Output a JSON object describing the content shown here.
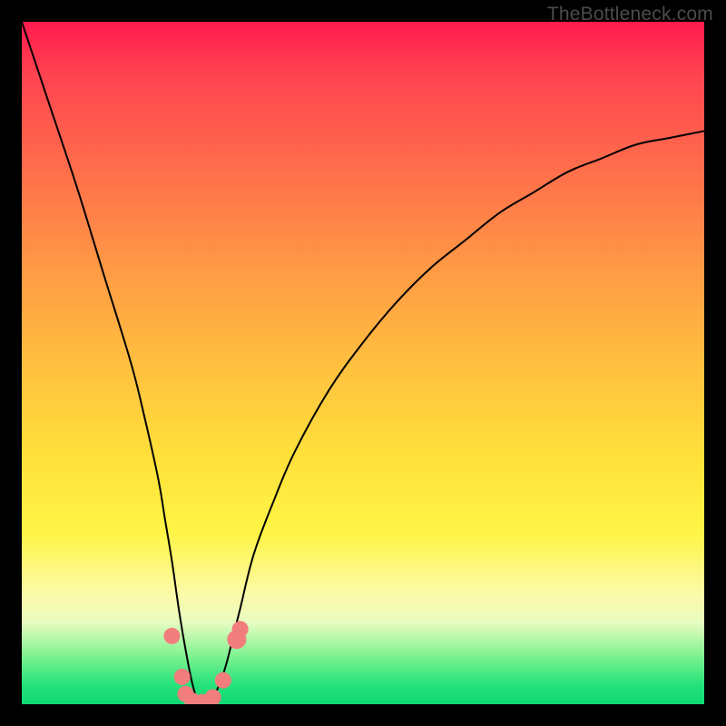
{
  "watermark": {
    "text": "TheBottleneck.com"
  },
  "chart_data": {
    "type": "line",
    "title": "",
    "xlabel": "",
    "ylabel": "",
    "xlim": [
      0,
      100
    ],
    "ylim": [
      0,
      100
    ],
    "grid": false,
    "legend": false,
    "background_gradient": {
      "direction": "vertical",
      "stops": [
        {
          "pos": 0.0,
          "color": "#ff1a4d"
        },
        {
          "pos": 0.22,
          "color": "#ff6f4b"
        },
        {
          "pos": 0.5,
          "color": "#ffbf3f"
        },
        {
          "pos": 0.75,
          "color": "#fff547"
        },
        {
          "pos": 0.88,
          "color": "#e8fcc0"
        },
        {
          "pos": 1.0,
          "color": "#0ed874"
        }
      ]
    },
    "series": [
      {
        "name": "bottleneck-curve",
        "color": "#000000",
        "x": [
          0,
          4,
          8,
          12,
          16,
          18,
          20,
          21,
          22,
          23,
          24,
          25,
          26,
          27,
          28,
          29,
          30,
          31,
          32,
          34,
          37,
          40,
          45,
          50,
          55,
          60,
          65,
          70,
          75,
          80,
          85,
          90,
          95,
          100
        ],
        "y": [
          100,
          88,
          76,
          63,
          50,
          42,
          33,
          27,
          21,
          14,
          8,
          3,
          0,
          0,
          1,
          3,
          6,
          10,
          14,
          22,
          30,
          37,
          46,
          53,
          59,
          64,
          68,
          72,
          75,
          78,
          80,
          82,
          83,
          84
        ]
      }
    ],
    "markers": [
      {
        "x": 22.0,
        "y": 10.0,
        "r": 1.2,
        "color": "#f27d7d"
      },
      {
        "x": 23.5,
        "y": 4.0,
        "r": 1.2,
        "color": "#f27d7d"
      },
      {
        "x": 24.0,
        "y": 1.5,
        "r": 1.2,
        "color": "#f27d7d"
      },
      {
        "x": 25.0,
        "y": 0.5,
        "r": 1.2,
        "color": "#f27d7d"
      },
      {
        "x": 26.5,
        "y": 0.3,
        "r": 1.2,
        "color": "#f27d7d"
      },
      {
        "x": 28.0,
        "y": 1.0,
        "r": 1.2,
        "color": "#f27d7d"
      },
      {
        "x": 29.5,
        "y": 3.5,
        "r": 1.2,
        "color": "#f27d7d"
      },
      {
        "x": 31.5,
        "y": 9.5,
        "r": 1.4,
        "color": "#f27d7d"
      },
      {
        "x": 32.0,
        "y": 11.0,
        "r": 1.2,
        "color": "#f27d7d"
      }
    ],
    "notch_minimum_x": 26
  }
}
